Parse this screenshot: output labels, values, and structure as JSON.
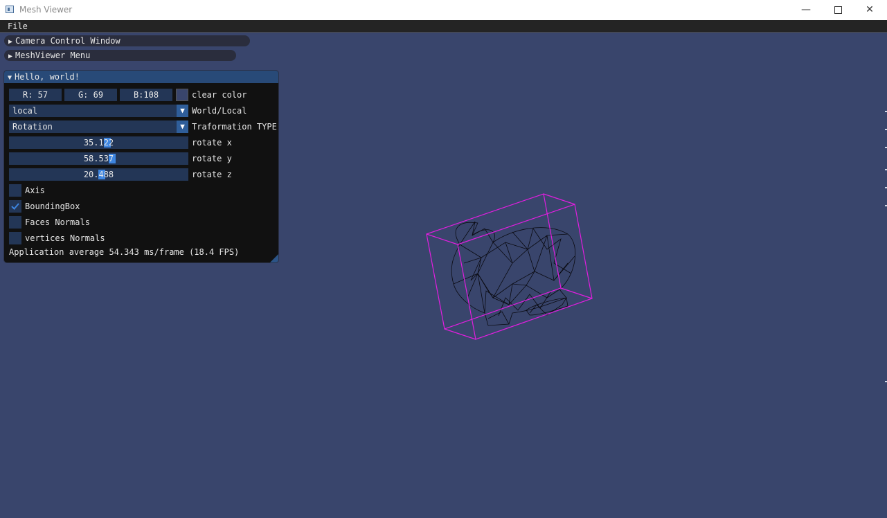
{
  "window": {
    "title": "Mesh Viewer"
  },
  "menubar": {
    "file": "File"
  },
  "collapsed": {
    "camera": "Camera Control Window",
    "meshviewer": "MeshViewer Menu"
  },
  "panel": {
    "title": "Hello, world!",
    "color": {
      "r": "R: 57",
      "g": "G: 69",
      "b": "B:108",
      "label": "clear color",
      "swatch": "#39456c"
    },
    "space_combo": {
      "value": "local",
      "label": "World/Local"
    },
    "type_combo": {
      "value": "Rotation",
      "label": "Traformation TYPE"
    },
    "rotate_x": {
      "value": "35.122",
      "label": "rotate x",
      "level": 0.55
    },
    "rotate_y": {
      "value": "58.537",
      "label": "rotate y",
      "level": 0.58
    },
    "rotate_z": {
      "value": "20.488",
      "label": "rotate z",
      "level": 0.52
    },
    "checks": {
      "axis": {
        "label": "Axis",
        "checked": false
      },
      "bbox": {
        "label": "BoundingBox",
        "checked": true
      },
      "faces": {
        "label": "Faces Normals",
        "checked": false
      },
      "vertices": {
        "label": "vertices Normals",
        "checked": false
      }
    },
    "status": "Application average 54.343 ms/frame (18.4 FPS)"
  },
  "colors": {
    "background": "#39456c",
    "bbox": "#e21ee0",
    "mesh": "#0a0a10",
    "accent": "#3d85e0"
  }
}
